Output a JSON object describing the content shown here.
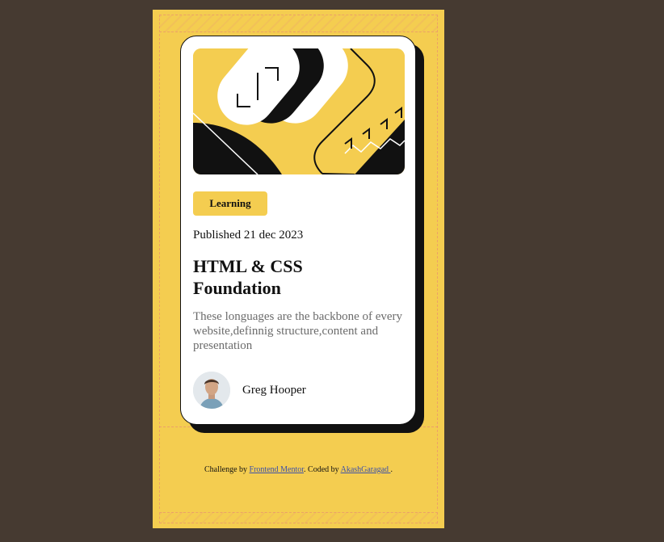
{
  "card": {
    "tag": "Learning",
    "published": "Published 21 dec 2023",
    "title": "HTML & CSS Foundation",
    "description": "These longuages are the backbone of every website,definnig structure,content and presentation",
    "author": "Greg Hooper"
  },
  "footer": {
    "prefix": "Challenge by ",
    "link1": "Frontend Mentor",
    "middle": ". Coded by ",
    "link2": "AkashGaragad ",
    "suffix": "."
  },
  "colors": {
    "background": "#463a31",
    "accent": "#f4cd50",
    "card": "#ffffff",
    "ink": "#111111"
  },
  "icons": {
    "hero": "abstract-illustration",
    "avatar": "author-photo"
  }
}
